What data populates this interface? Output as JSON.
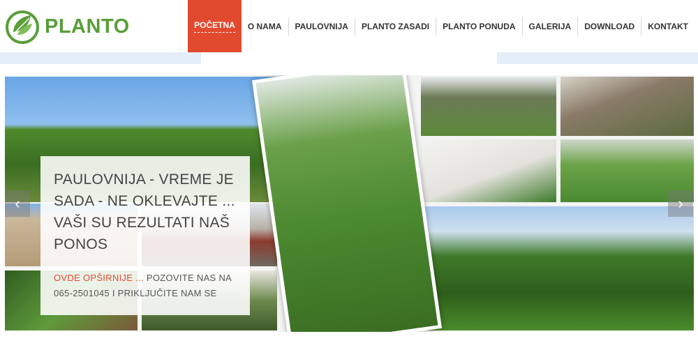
{
  "brand": {
    "name": "PLANTO",
    "logo_icon": "leaf-circle-icon",
    "color": "#5a9e3a"
  },
  "nav": {
    "items": [
      {
        "label": "Početna"
      },
      {
        "label": "O NAMA"
      },
      {
        "label": "PAULOVNIJA"
      },
      {
        "label": "PLANTO ZASADI"
      },
      {
        "label": "PLANTO PONUDA"
      },
      {
        "label": "GALERIJA"
      },
      {
        "label": "DOWNLOAD"
      },
      {
        "label": "KONTAKT"
      }
    ],
    "active_index": 0,
    "active_color": "#e24a2f"
  },
  "slider": {
    "caption_title": "PAULOVNIJA - VREME JE SADA - NE OKLEVAJTE ... VAŠI SU REZULTATI NAŠ PONOS",
    "caption_link": "OVDE OPŠIRNIJE ...",
    "caption_text": "POZOVITE NAS NA 065-2501045 I PRIKLJUČITE NAM SE",
    "prev_icon": "chevron-left-icon",
    "next_icon": "chevron-right-icon"
  }
}
